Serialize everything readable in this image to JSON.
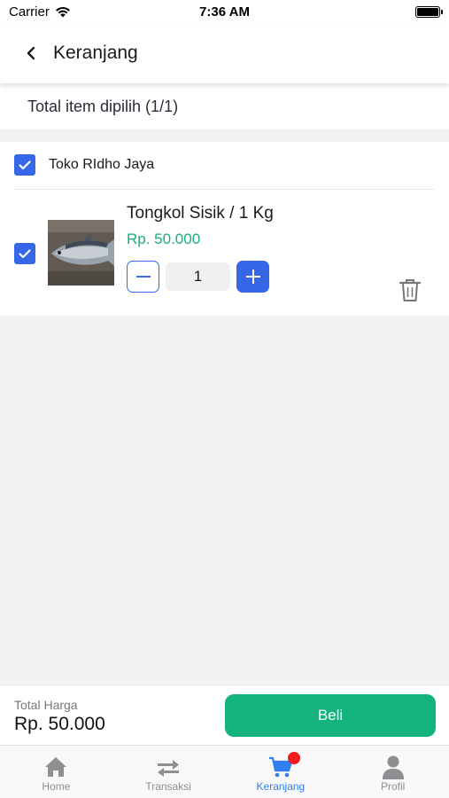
{
  "status_bar": {
    "carrier": "Carrier",
    "time": "7:36 AM"
  },
  "header": {
    "title": "Keranjang",
    "back_icon": "chevron-left-icon"
  },
  "summary": {
    "text": "Total item dipilih (1/1)"
  },
  "store": {
    "name": "Toko RIdho Jaya",
    "checked": true,
    "items": [
      {
        "name": "Tongkol Sisik / 1 Kg",
        "price": "Rp. 50.000",
        "quantity": "1",
        "checked": true,
        "image": "fish-photo"
      }
    ]
  },
  "footer": {
    "total_label": "Total Harga",
    "total_value": "Rp. 50.000",
    "buy_label": "Beli"
  },
  "tabbar": {
    "tabs": [
      {
        "label": "Home",
        "icon": "home-icon",
        "active": false
      },
      {
        "label": "Transaksi",
        "icon": "transfer-arrows-icon",
        "active": false
      },
      {
        "label": "Keranjang",
        "icon": "cart-icon",
        "active": true,
        "badge": true
      },
      {
        "label": "Profil",
        "icon": "user-icon",
        "active": false
      }
    ]
  },
  "colors": {
    "accent_blue": "#3567e6",
    "price_green": "#17b07a",
    "buy_green": "#13b37b",
    "active_tab": "#2f7ff0",
    "badge_red": "#f01b1b"
  }
}
